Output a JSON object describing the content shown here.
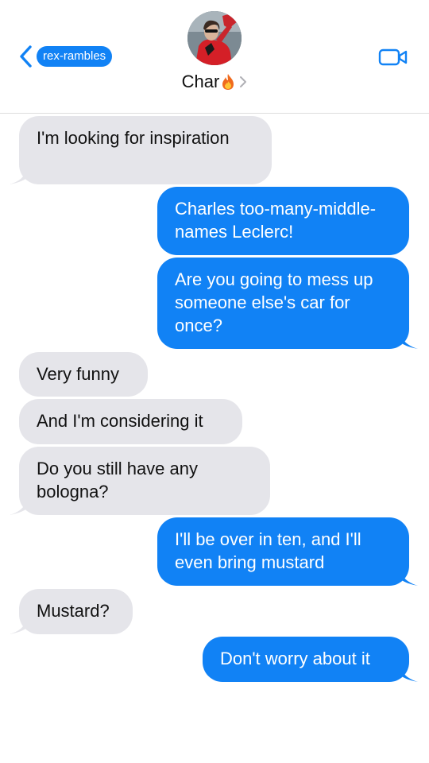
{
  "header": {
    "back_label": "rex-rambles",
    "contact_name": "Char",
    "icons": {
      "back": "chevron-left-icon",
      "contact_emoji": "fire-icon",
      "contact_chevron": "chevron-right-icon",
      "video": "video-camera-icon"
    }
  },
  "colors": {
    "accent": "#1182f5",
    "incoming_bubble": "#e5e5ea",
    "outgoing_bubble": "#1182f5"
  },
  "messages": [
    {
      "dir": "in",
      "text": "I'm looking for inspiration"
    },
    {
      "dir": "out",
      "text": "Charles too-many-middle-names Leclerc!"
    },
    {
      "dir": "out",
      "text": "Are you going to mess up someone else's car for once?"
    },
    {
      "dir": "in",
      "text": "Very funny"
    },
    {
      "dir": "in",
      "text": "And I'm considering it"
    },
    {
      "dir": "in",
      "text": "Do you still have any bologna?"
    },
    {
      "dir": "out",
      "text": "I'll be over in ten, and I'll even bring mustard"
    },
    {
      "dir": "in",
      "text": "Mustard?"
    },
    {
      "dir": "out",
      "text": "Don't worry about it"
    }
  ]
}
